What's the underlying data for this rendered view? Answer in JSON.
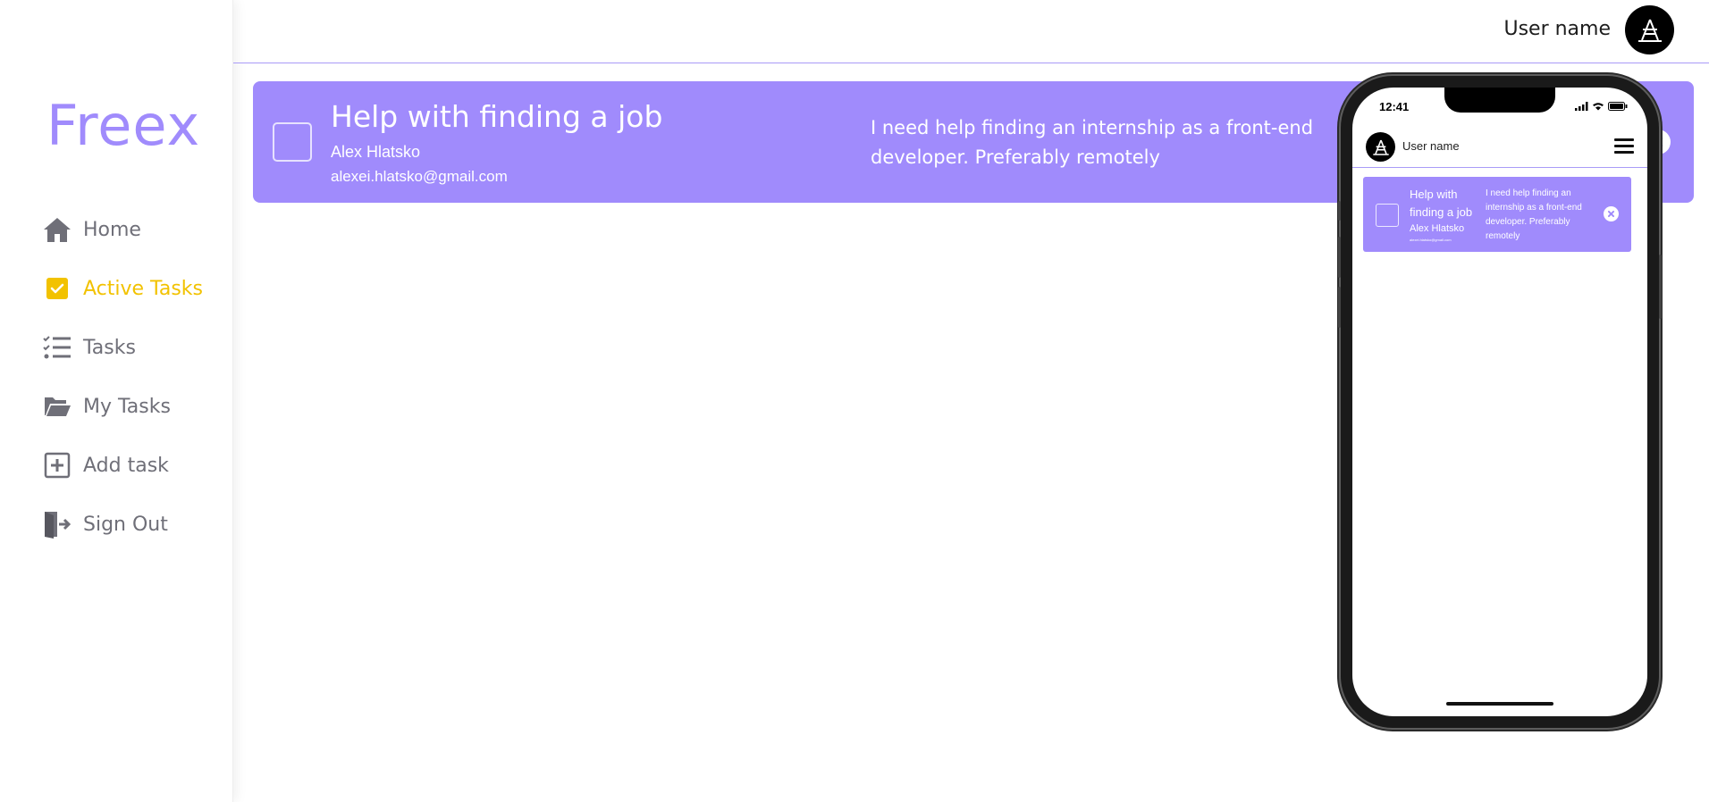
{
  "app": {
    "logo": "Freex"
  },
  "sidebar": {
    "items": [
      {
        "label": "Home",
        "icon": "home-icon",
        "active": false
      },
      {
        "label": "Active Tasks",
        "icon": "checkbox-checked-icon",
        "active": true
      },
      {
        "label": "Tasks",
        "icon": "checklist-icon",
        "active": false
      },
      {
        "label": "My Tasks",
        "icon": "folder-open-icon",
        "active": false
      },
      {
        "label": "Add task",
        "icon": "plus-square-icon",
        "active": false
      },
      {
        "label": "Sign Out",
        "icon": "sign-out-icon",
        "active": false
      }
    ]
  },
  "header": {
    "username": "User name",
    "avatar_icon": "logo-avatar-icon"
  },
  "task": {
    "title": "Help with finding a job",
    "author": "Alex Hlatsko",
    "email": "alexei.hlatsko@gmail.com",
    "description": "I need help finding an internship as a front-end developer. Preferably remotely"
  },
  "phone": {
    "time": "12:41",
    "username": "User name",
    "task": {
      "title": "Help with finding a job",
      "author": "Alex Hlatsko",
      "email": "alexei.hlatsko@gmail.com",
      "description": "I need help finding an internship as a front-end developer. Preferably remotely"
    }
  },
  "colors": {
    "accent": "#a08bfc",
    "active": "#f2c200",
    "nav_text": "#6f6f78"
  }
}
